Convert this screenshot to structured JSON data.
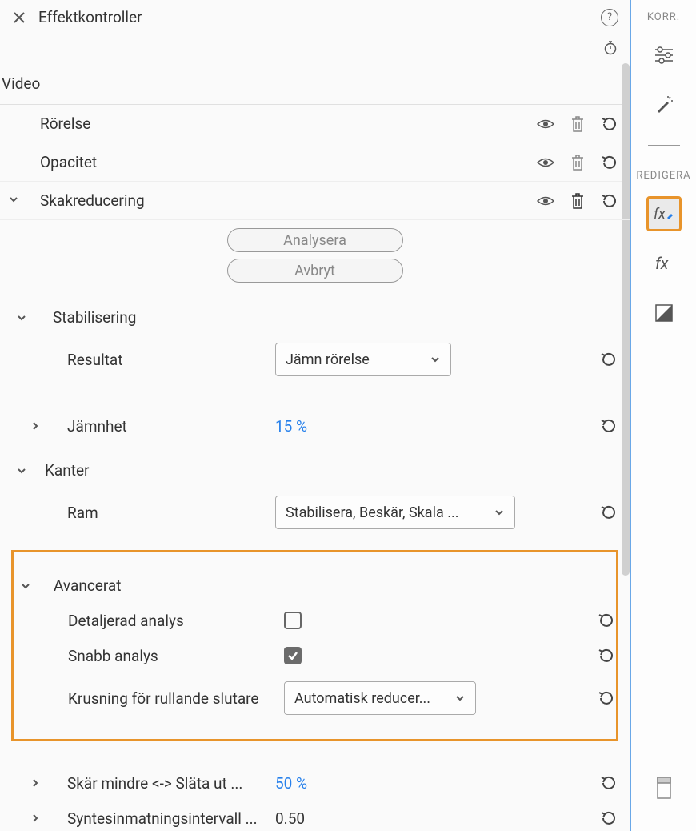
{
  "panel": {
    "title": "Effektkontroller"
  },
  "section": "Video",
  "effects": {
    "motion": {
      "label": "Rörelse"
    },
    "opacity": {
      "label": "Opacitet"
    },
    "shake": {
      "label": "Skakreducering"
    }
  },
  "buttons": {
    "analyze": "Analysera",
    "cancel": "Avbryt"
  },
  "stabilization": {
    "header": "Stabilisering",
    "result_label": "Resultat",
    "result_value": "Jämn rörelse",
    "smoothness_label": "Jämnhet",
    "smoothness_value": "15 %"
  },
  "edges": {
    "header": "Kanter",
    "frame_label": "Ram",
    "frame_value": "Stabilisera, Beskär, Skala ..."
  },
  "advanced": {
    "header": "Avancerat",
    "detailed_label": "Detaljerad analys",
    "detailed_checked": false,
    "fast_label": "Snabb analys",
    "fast_checked": true,
    "ripple_label": "Krusning för rullande slutare",
    "ripple_value": "Automatisk reducer..."
  },
  "crop": {
    "crop_smooth_label": "Skär mindre <-> Släta ut ...",
    "crop_smooth_value": "50 %",
    "synth_label": "Syntesinmatningsintervall ...",
    "synth_value": "0.50"
  },
  "sidebar": {
    "cat1": "KORR.",
    "cat2": "REDIGERA"
  }
}
